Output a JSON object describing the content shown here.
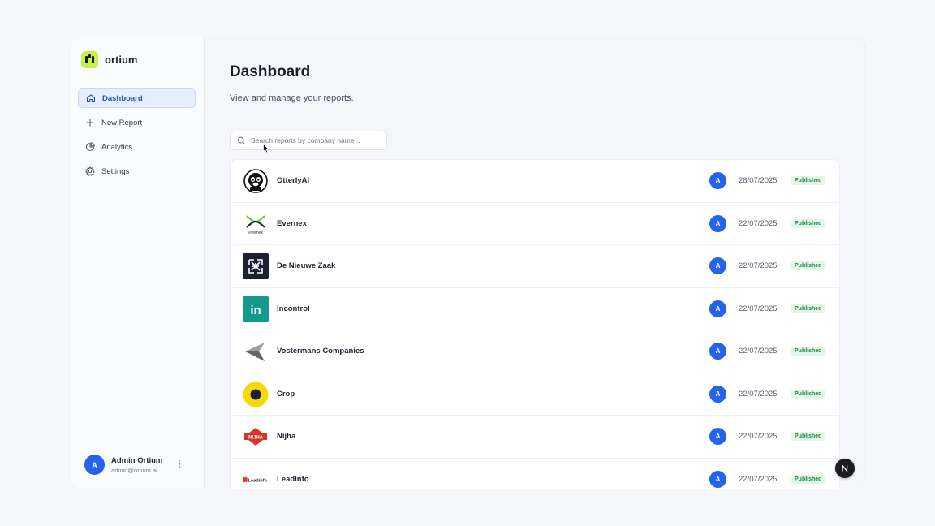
{
  "brand": {
    "name": "ortium",
    "accent": "#c8f24a"
  },
  "sidebar": {
    "items": [
      {
        "label": "Dashboard",
        "icon": "home-icon",
        "active": true
      },
      {
        "label": "New Report",
        "icon": "plus-icon",
        "active": false
      },
      {
        "label": "Analytics",
        "icon": "pie-chart-icon",
        "active": false
      },
      {
        "label": "Settings",
        "icon": "gear-icon",
        "active": false
      }
    ],
    "user": {
      "initial": "A",
      "name": "Admin Ortium",
      "email": "admin@ortium.ai",
      "menu_icon": "⋮"
    }
  },
  "main": {
    "title": "Dashboard",
    "subtitle": "View and manage your reports.",
    "search": {
      "placeholder": "Search reports by company name...",
      "value": ""
    }
  },
  "reports": [
    {
      "company": "OtterlyAI",
      "logo": "otterly-logo",
      "author_initial": "A",
      "date": "28/07/2025",
      "status": "Published"
    },
    {
      "company": "Evernex",
      "logo": "evernex-logo",
      "logo_text": "evernex",
      "author_initial": "A",
      "date": "22/07/2025",
      "status": "Published"
    },
    {
      "company": "De Nieuwe Zaak",
      "logo": "de-nieuwe-zaak-logo",
      "author_initial": "A",
      "date": "22/07/2025",
      "status": "Published"
    },
    {
      "company": "Incontrol",
      "logo": "incontrol-logo",
      "logo_text": "in",
      "author_initial": "A",
      "date": "22/07/2025",
      "status": "Published"
    },
    {
      "company": "Vostermans Companies",
      "logo": "vostermans-logo",
      "author_initial": "A",
      "date": "22/07/2025",
      "status": "Published"
    },
    {
      "company": "Crop",
      "logo": "crop-logo",
      "author_initial": "A",
      "date": "22/07/2025",
      "status": "Published"
    },
    {
      "company": "Nijha",
      "logo": "nijha-logo",
      "logo_text": "NIJHA",
      "author_initial": "A",
      "date": "22/07/2025",
      "status": "Published"
    },
    {
      "company": "LeadInfo",
      "logo": "leadinfo-logo",
      "logo_text": "Leadinfo",
      "author_initial": "A",
      "date": "22/07/2025",
      "status": "Published"
    }
  ],
  "colors": {
    "primary": "#2563eb",
    "published_bg": "#e3f6e9",
    "published_text": "#1c8a46"
  }
}
